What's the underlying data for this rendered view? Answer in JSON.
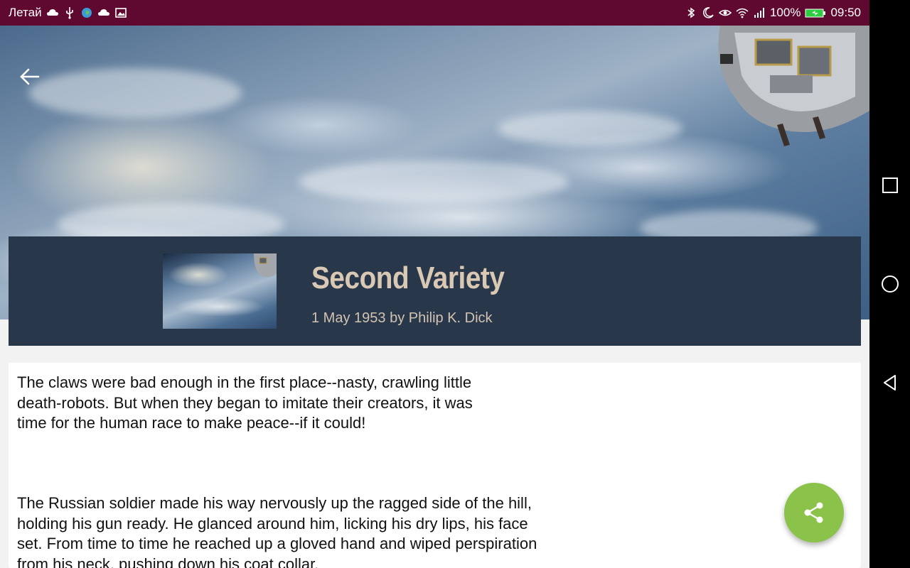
{
  "status_bar": {
    "carrier": "Летай",
    "battery": "100%",
    "time": "09:50",
    "background": "#5f0930"
  },
  "hero": {
    "back_icon": "arrow-left-icon"
  },
  "story": {
    "title": "Second Variety",
    "meta": "1 May 1953 by Philip K. Dick",
    "card_color": "#28384a",
    "title_color": "#d9c8b4"
  },
  "content": {
    "paragraphs": [
      "The claws were bad enough in the first place--nasty, crawling little death-robots. But when they began to imitate their creators, it was time for the human race to make peace--if it could!",
      "The Russian soldier made his way nervously up the ragged side of the hill, holding his gun ready. He glanced around him, licking his dry lips, his face set. From time to time he reached up a gloved hand and wiped perspiration from his neck, pushing down his coat collar."
    ]
  },
  "fab": {
    "icon": "share-icon",
    "color": "#8bc34a"
  },
  "nav_bar": {
    "icons": [
      "square-recent-icon",
      "circle-home-icon",
      "triangle-back-icon"
    ]
  }
}
